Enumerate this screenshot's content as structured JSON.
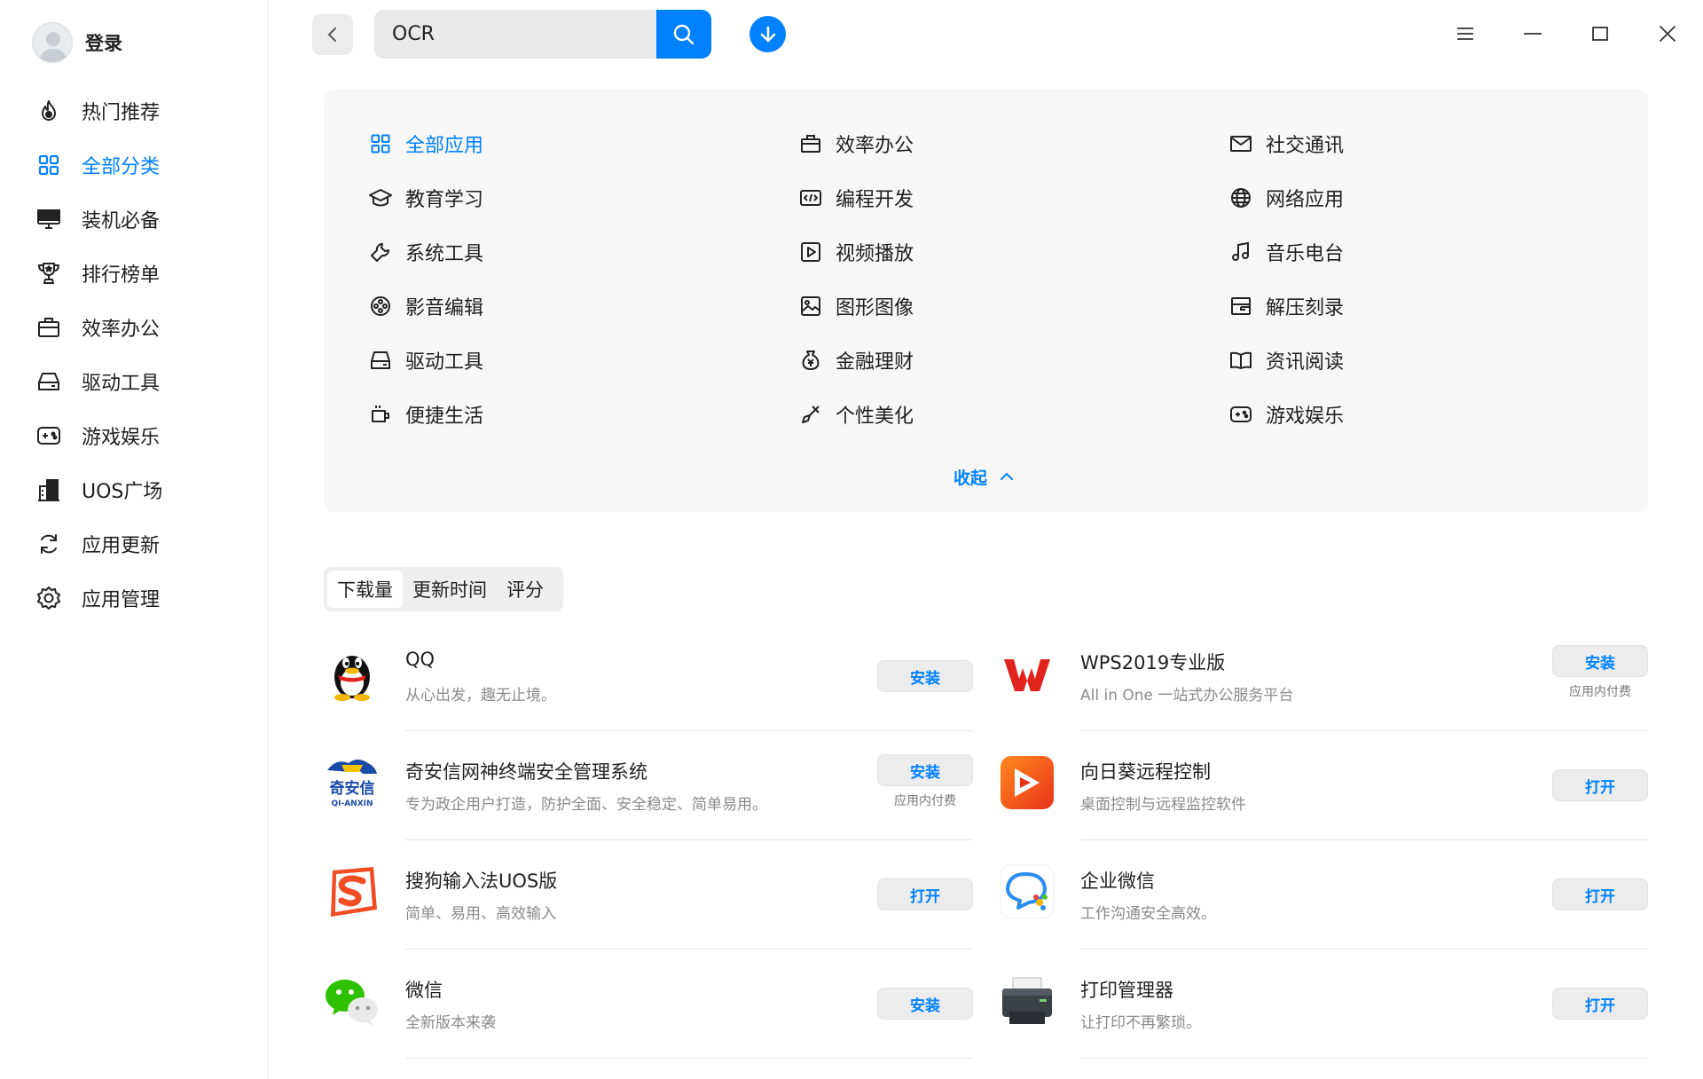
{
  "user": {
    "name": "登录",
    "avatar_icon": "user-avatar-icon"
  },
  "sidebar": {
    "items": [
      {
        "label": "热门推荐",
        "icon": "flame-icon",
        "active": false
      },
      {
        "label": "全部分类",
        "icon": "grid-icon",
        "active": true
      },
      {
        "label": "装机必备",
        "icon": "monitor-icon",
        "active": false
      },
      {
        "label": "排行榜单",
        "icon": "trophy-icon",
        "active": false
      },
      {
        "label": "效率办公",
        "icon": "briefcase-icon",
        "active": false
      },
      {
        "label": "驱动工具",
        "icon": "drive-icon",
        "active": false
      },
      {
        "label": "游戏娱乐",
        "icon": "gamepad-icon",
        "active": false
      },
      {
        "label": "UOS广场",
        "icon": "building-icon",
        "active": false
      },
      {
        "label": "应用更新",
        "icon": "refresh-icon",
        "active": false
      },
      {
        "label": "应用管理",
        "icon": "gear-icon",
        "active": false
      }
    ]
  },
  "search": {
    "value": "OCR",
    "placeholder": ""
  },
  "colors": {
    "accent": "#0081ff",
    "panel": "#f7f7f7",
    "button_bg": "#ececec"
  },
  "categories": {
    "items": [
      {
        "label": "全部应用",
        "icon": "grid-icon",
        "active": true
      },
      {
        "label": "效率办公",
        "icon": "briefcase-icon"
      },
      {
        "label": "社交通讯",
        "icon": "mail-icon"
      },
      {
        "label": "教育学习",
        "icon": "graduation-cap-icon"
      },
      {
        "label": "编程开发",
        "icon": "code-icon"
      },
      {
        "label": "网络应用",
        "icon": "globe-icon"
      },
      {
        "label": "系统工具",
        "icon": "wrench-icon"
      },
      {
        "label": "视频播放",
        "icon": "play-icon"
      },
      {
        "label": "音乐电台",
        "icon": "music-note-icon"
      },
      {
        "label": "影音编辑",
        "icon": "film-reel-icon"
      },
      {
        "label": "图形图像",
        "icon": "image-icon"
      },
      {
        "label": "解压刻录",
        "icon": "archive-icon"
      },
      {
        "label": "驱动工具",
        "icon": "drive-icon"
      },
      {
        "label": "金融理财",
        "icon": "money-bag-icon"
      },
      {
        "label": "资讯阅读",
        "icon": "book-icon"
      },
      {
        "label": "便捷生活",
        "icon": "cup-icon"
      },
      {
        "label": "个性美化",
        "icon": "brush-icon"
      },
      {
        "label": "游戏娱乐",
        "icon": "gamepad-icon"
      }
    ],
    "collapse_label": "收起"
  },
  "sort_tabs": [
    {
      "label": "下载量",
      "active": true
    },
    {
      "label": "更新时间",
      "active": false
    },
    {
      "label": "评分",
      "active": false
    }
  ],
  "apps": [
    {
      "name": "QQ",
      "desc": "从心出发，趣无止境。",
      "action": "安装",
      "note": "",
      "icon": "qq-penguin-icon"
    },
    {
      "name": "WPS2019专业版",
      "desc": "All in One 一站式办公服务平台",
      "action": "安装",
      "note": "应用内付费",
      "icon": "wps-logo-icon"
    },
    {
      "name": "奇安信网神终端安全管理系统",
      "desc": "专为政企用户打造，防护全面、安全稳定、简单易用。",
      "action": "安装",
      "note": "应用内付费",
      "icon": "qianxin-logo-icon",
      "logo_text": "奇安信",
      "logo_sub": "QI-ANXIN"
    },
    {
      "name": "向日葵远程控制",
      "desc": "桌面控制与远程监控软件",
      "action": "打开",
      "note": "",
      "icon": "sunflower-remote-icon"
    },
    {
      "name": "搜狗输入法UOS版",
      "desc": "简单、易用、高效输入",
      "action": "打开",
      "note": "",
      "icon": "sogou-logo-icon"
    },
    {
      "name": "企业微信",
      "desc": "工作沟通安全高效。",
      "action": "打开",
      "note": "",
      "icon": "wecom-logo-icon"
    },
    {
      "name": "微信",
      "desc": "全新版本来袭",
      "action": "安装",
      "note": "",
      "icon": "wechat-logo-icon"
    },
    {
      "name": "打印管理器",
      "desc": "让打印不再繁琐。",
      "action": "打开",
      "note": "",
      "icon": "printer-icon"
    }
  ]
}
